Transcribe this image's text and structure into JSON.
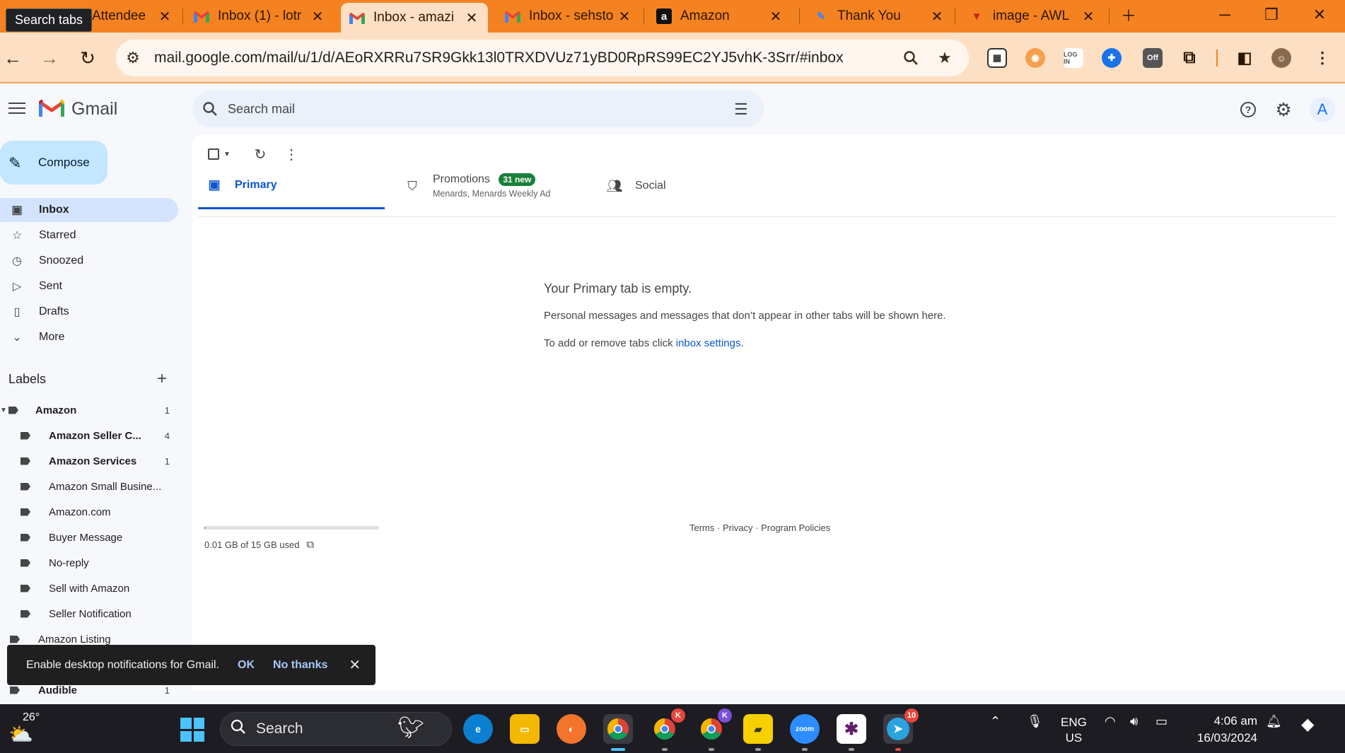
{
  "browser": {
    "tooltip": "Search tabs",
    "tabs": [
      {
        "title": "Attendee",
        "favicon": "zoom-icon"
      },
      {
        "title": "Inbox (1) - lotr",
        "favicon": "gmail-icon"
      },
      {
        "title": "Inbox - amazi",
        "favicon": "gmail-icon",
        "active": true
      },
      {
        "title": "Inbox - sehsto",
        "favicon": "gmail-icon"
      },
      {
        "title": "Amazon",
        "favicon": "amazon-icon"
      },
      {
        "title": "Thank You",
        "favicon": "pen-icon"
      },
      {
        "title": "image - AWL",
        "favicon": "heart-icon"
      }
    ],
    "url": "mail.google.com/mail/u/1/d/AEoRXRRu7SR9Gkk13l0TRXDVUz71yBD0RpRS99EC2YJ5vhK-3Srr/#inbox",
    "accent": "#f58220"
  },
  "gmail": {
    "brand": "Gmail",
    "search_placeholder": "Search mail",
    "avatar_letter": "A",
    "compose_label": "Compose",
    "nav": [
      {
        "label": "Inbox",
        "icon": "inbox-icon",
        "active": true
      },
      {
        "label": "Starred",
        "icon": "star-icon"
      },
      {
        "label": "Snoozed",
        "icon": "clock-icon"
      },
      {
        "label": "Sent",
        "icon": "send-icon"
      },
      {
        "label": "Drafts",
        "icon": "draft-icon"
      },
      {
        "label": "More",
        "icon": "chevron-down-icon"
      }
    ],
    "labels_title": "Labels",
    "labels": [
      {
        "name": "Amazon",
        "count": "1",
        "bold": true,
        "level": 0
      },
      {
        "name": "Amazon Seller C...",
        "count": "4",
        "bold": true,
        "level": 1
      },
      {
        "name": "Amazon Services",
        "count": "1",
        "bold": true,
        "level": 1
      },
      {
        "name": "Amazon Small Busine...",
        "count": "",
        "bold": false,
        "level": 1
      },
      {
        "name": "Amazon.com",
        "count": "",
        "bold": false,
        "level": 1
      },
      {
        "name": "Buyer Message",
        "count": "",
        "bold": false,
        "level": 1
      },
      {
        "name": "No-reply",
        "count": "",
        "bold": false,
        "level": 1
      },
      {
        "name": "Sell with Amazon",
        "count": "",
        "bold": false,
        "level": 1
      },
      {
        "name": "Seller Notification",
        "count": "",
        "bold": false,
        "level": 1
      },
      {
        "name": "Amazon Listing",
        "count": "",
        "bold": false,
        "level": 0
      },
      {
        "name": "Audible",
        "count": "1",
        "bold": true,
        "level": 0
      }
    ],
    "tabs": {
      "primary": "Primary",
      "promotions": "Promotions",
      "promotions_badge": "31 new",
      "promotions_sub": "Menards, Menards Weekly Ad",
      "social": "Social"
    },
    "empty": {
      "title": "Your Primary tab is empty.",
      "line1": "Personal messages and messages that don’t appear in other tabs will be shown here.",
      "line2_prefix": "To add or remove tabs click ",
      "line2_link": "inbox settings",
      "line2_suffix": "."
    },
    "storage": {
      "text": "0.01 GB of 15 GB used",
      "fraction": 0.001
    },
    "footer": "Terms · Privacy · Program Policies",
    "snackbar": {
      "message": "Enable desktop notifications for Gmail.",
      "ok": "OK",
      "no_thanks": "No thanks"
    }
  },
  "taskbar": {
    "temperature": "26°",
    "search": "Search",
    "language": "ENG",
    "region": "US",
    "time": "4:06 am",
    "date": "16/03/2024",
    "telegram_badge": "10",
    "chrome_badge_1": "K",
    "chrome_badge_2": "K"
  }
}
